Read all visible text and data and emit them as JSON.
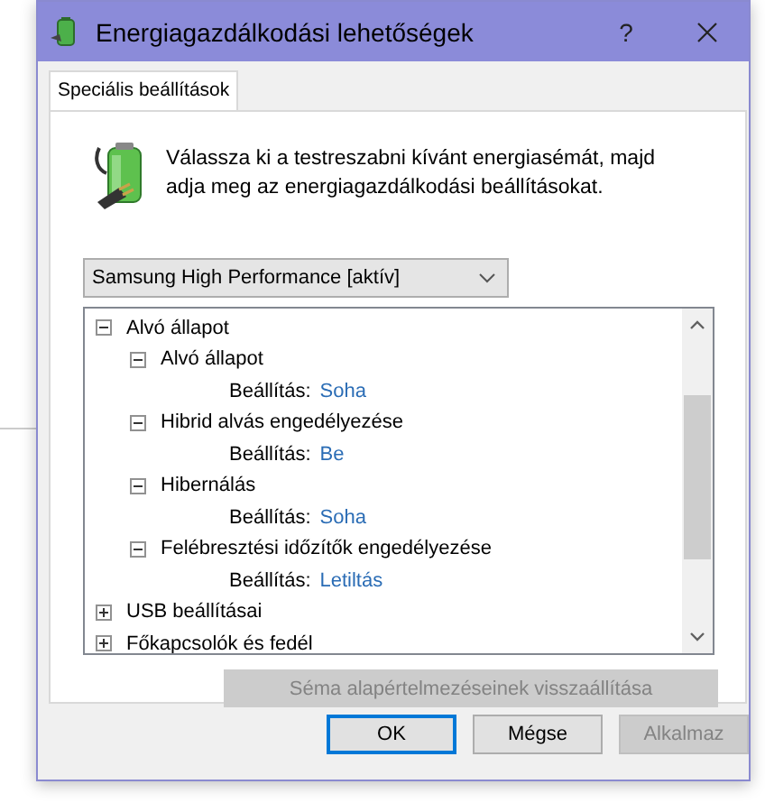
{
  "window": {
    "title": "Energiagazdálkodási lehetőségek",
    "help": "?"
  },
  "tabs": [
    {
      "label": "Speciális beállítások",
      "selected": true
    }
  ],
  "description": "Válassza ki a testreszabni kívánt energiasémát, majd adja meg az energiagazdálkodási beállításokat.",
  "plan_dropdown": {
    "value": "Samsung High Performance [aktív]"
  },
  "tree": [
    {
      "kind": "group",
      "label": "Alvó állapot",
      "expanded": true,
      "children": [
        {
          "kind": "group",
          "label": "Alvó állapot",
          "expanded": true,
          "children": [
            {
              "kind": "setting",
              "label": "Beállítás:",
              "value": "Soha"
            }
          ]
        },
        {
          "kind": "group",
          "label": "Hibrid alvás engedélyezése",
          "expanded": true,
          "children": [
            {
              "kind": "setting",
              "label": "Beállítás:",
              "value": "Be"
            }
          ]
        },
        {
          "kind": "group",
          "label": "Hibernálás",
          "expanded": true,
          "children": [
            {
              "kind": "setting",
              "label": "Beállítás:",
              "value": "Soha"
            }
          ]
        },
        {
          "kind": "group",
          "label": "Felébresztési időzítők engedélyezése",
          "expanded": true,
          "children": [
            {
              "kind": "setting",
              "label": "Beállítás:",
              "value": "Letiltás"
            }
          ]
        }
      ]
    },
    {
      "kind": "group",
      "label": "USB beállításai",
      "expanded": false
    },
    {
      "kind": "group",
      "label": "Főkapcsolók és fedél",
      "expanded": false
    }
  ],
  "restore_button": {
    "label": "Séma alapértelmezéseinek visszaállítása",
    "disabled": true
  },
  "buttons": [
    {
      "label": "OK",
      "disabled": false,
      "default": true
    },
    {
      "label": "Mégse",
      "disabled": false,
      "default": false
    },
    {
      "label": "Alkalmaz",
      "disabled": true,
      "default": false
    }
  ]
}
